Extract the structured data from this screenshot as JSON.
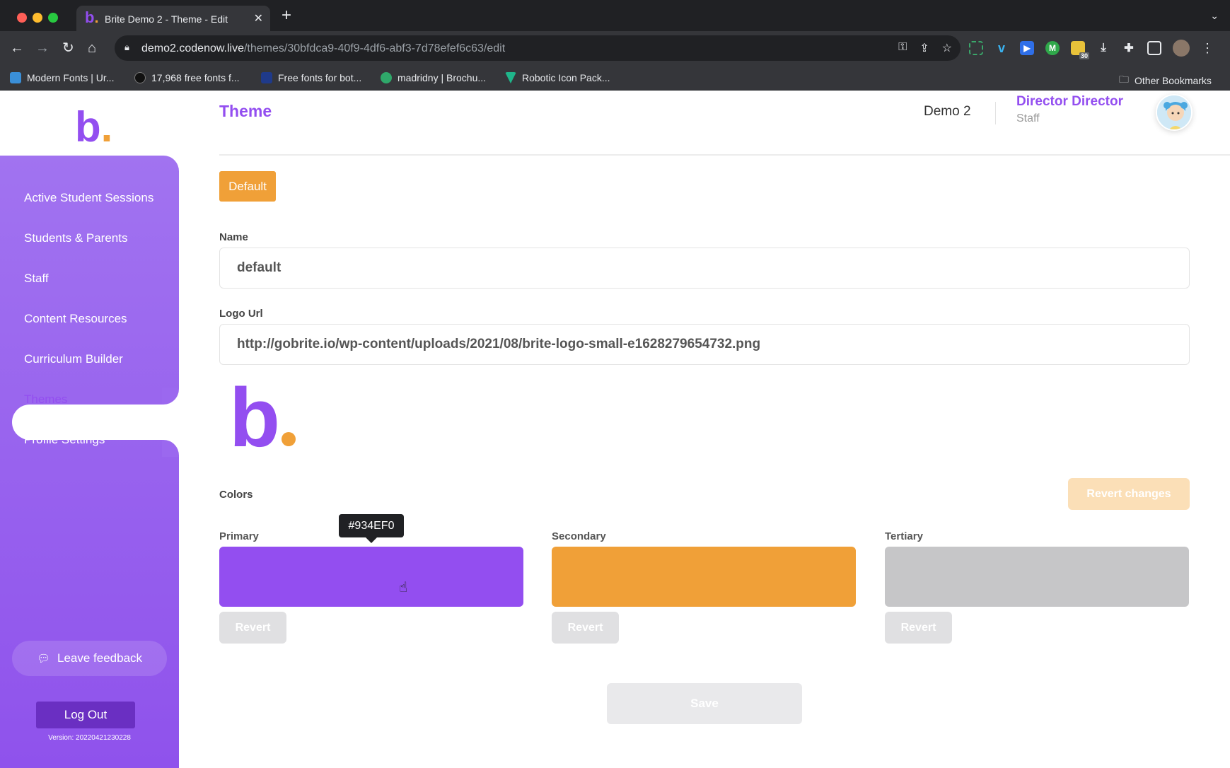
{
  "browser": {
    "tab_title": "Brite Demo 2 - Theme - Edit",
    "url_host": "demo2.codenow.live",
    "url_path": "/themes/30bfdca9-40f9-4df6-abf3-7d78efef6c63/edit",
    "bookmarks": [
      {
        "label": "Modern Fonts | Ur...",
        "color": "#3a8fd8"
      },
      {
        "label": "17,968 free fonts f...",
        "color": "#111111"
      },
      {
        "label": "Free fonts for bot...",
        "color": "#1f3a8a"
      },
      {
        "label": "madridny | Brochu...",
        "color": "#2fa86a"
      },
      {
        "label": "Robotic Icon Pack...",
        "color": "#1fb58a"
      }
    ],
    "other_bookmarks": "Other Bookmarks",
    "extension_badge": "30"
  },
  "app": {
    "logo_letter": "b",
    "logo_dot": ".",
    "page_title": "Theme",
    "org_name": "Demo 2",
    "user_name": "Director Director",
    "user_role": "Staff"
  },
  "sidebar": {
    "items": [
      {
        "label": "Active Student Sessions"
      },
      {
        "label": "Students & Parents"
      },
      {
        "label": "Staff"
      },
      {
        "label": "Content Resources"
      },
      {
        "label": "Curriculum Builder"
      },
      {
        "label": "Themes"
      },
      {
        "label": "Profile Settings"
      }
    ],
    "active_item": "Themes",
    "feedback_label": "Leave feedback",
    "logout_label": "Log Out",
    "version": "Version: 20220421230228"
  },
  "form": {
    "badge": "Default",
    "name_label": "Name",
    "name_value": "default",
    "logo_url_label": "Logo Url",
    "logo_url_value": "http://gobrite.io/wp-content/uploads/2021/08/brite-logo-small-e1628279654732.png",
    "colors_label": "Colors",
    "revert_changes_label": "Revert changes",
    "colors": [
      {
        "label": "Primary",
        "value": "#934EF0",
        "hex": "#934ef0",
        "revert_label": "Revert"
      },
      {
        "label": "Secondary",
        "value": "#F0A038",
        "hex": "#f0a038",
        "revert_label": "Revert"
      },
      {
        "label": "Tertiary",
        "value": "#C6C6C8",
        "hex": "#c6c6c8",
        "revert_label": "Revert"
      }
    ],
    "tooltip": "#934EF0",
    "save_label": "Save"
  }
}
